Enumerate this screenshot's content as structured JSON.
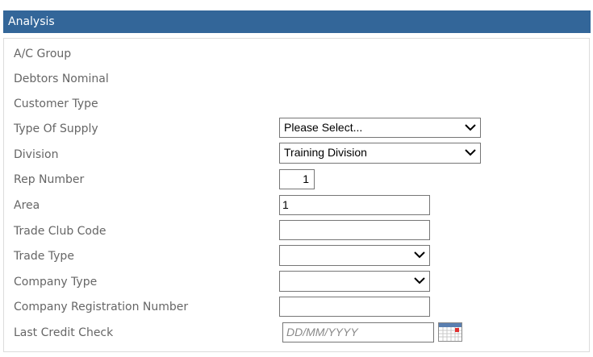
{
  "section": {
    "title": "Analysis"
  },
  "fields": {
    "ac_group": {
      "label": "A/C Group"
    },
    "debtors_nominal": {
      "label": "Debtors Nominal"
    },
    "customer_type": {
      "label": "Customer Type"
    },
    "type_of_supply": {
      "label": "Type Of Supply",
      "value": "Please Select..."
    },
    "division": {
      "label": "Division",
      "value": "Training Division"
    },
    "rep_number": {
      "label": "Rep Number",
      "value": "1"
    },
    "area": {
      "label": "Area",
      "value": "1"
    },
    "trade_club_code": {
      "label": "Trade Club Code",
      "value": ""
    },
    "trade_type": {
      "label": "Trade Type",
      "value": ""
    },
    "company_type": {
      "label": "Company Type",
      "value": ""
    },
    "company_registration_number": {
      "label": "Company Registration Number",
      "value": ""
    },
    "last_credit_check": {
      "label": "Last Credit Check",
      "placeholder": "DD/MM/YYYY",
      "value": ""
    }
  },
  "icons": {
    "dropdown": "chevron-down-icon",
    "calendar": "calendar-icon"
  }
}
